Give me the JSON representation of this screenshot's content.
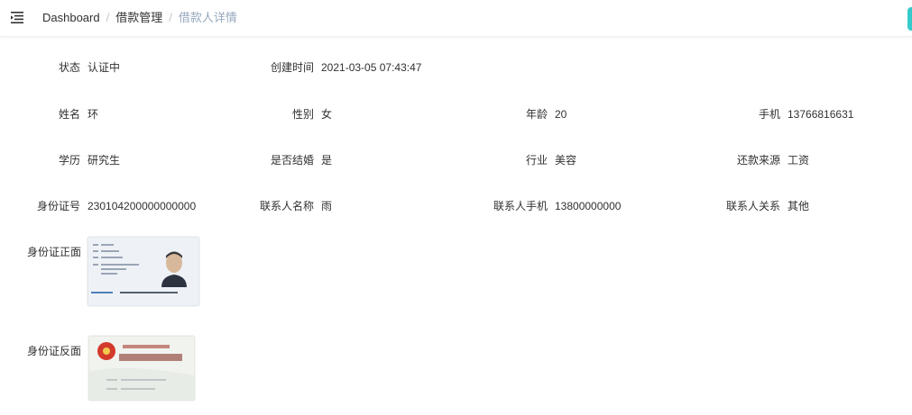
{
  "breadcrumb": {
    "items": [
      "Dashboard",
      "借款管理",
      "借款人详情"
    ],
    "separator": "/"
  },
  "header": {
    "menu_icon": "hamburger-icon"
  },
  "detail": {
    "status": {
      "label": "状态",
      "value": "认证中"
    },
    "created_at": {
      "label": "创建时间",
      "value": "2021-03-05 07:43:47"
    },
    "name": {
      "label": "姓名",
      "value": "环"
    },
    "gender": {
      "label": "性别",
      "value": "女"
    },
    "age": {
      "label": "年龄",
      "value": "20"
    },
    "phone": {
      "label": "手机",
      "value": "13766816631"
    },
    "education": {
      "label": "学历",
      "value": "研究生"
    },
    "married": {
      "label": "是否结婚",
      "value": "是"
    },
    "industry": {
      "label": "行业",
      "value": "美容"
    },
    "repay_source": {
      "label": "还款来源",
      "value": "工资"
    },
    "id_number": {
      "label": "身份证号",
      "value": "230104200000000000"
    },
    "contact_name": {
      "label": "联系人名称",
      "value": "雨"
    },
    "contact_phone": {
      "label": "联系人手机",
      "value": "13800000000"
    },
    "contact_relation": {
      "label": "联系人关系",
      "value": "其他"
    }
  },
  "photos": {
    "front_label": "身份证正面",
    "back_label": "身份证反面"
  },
  "colors": {
    "text": "#303133",
    "breadcrumb_current": "#97a8be",
    "edge_accent": "#13c2c2"
  }
}
